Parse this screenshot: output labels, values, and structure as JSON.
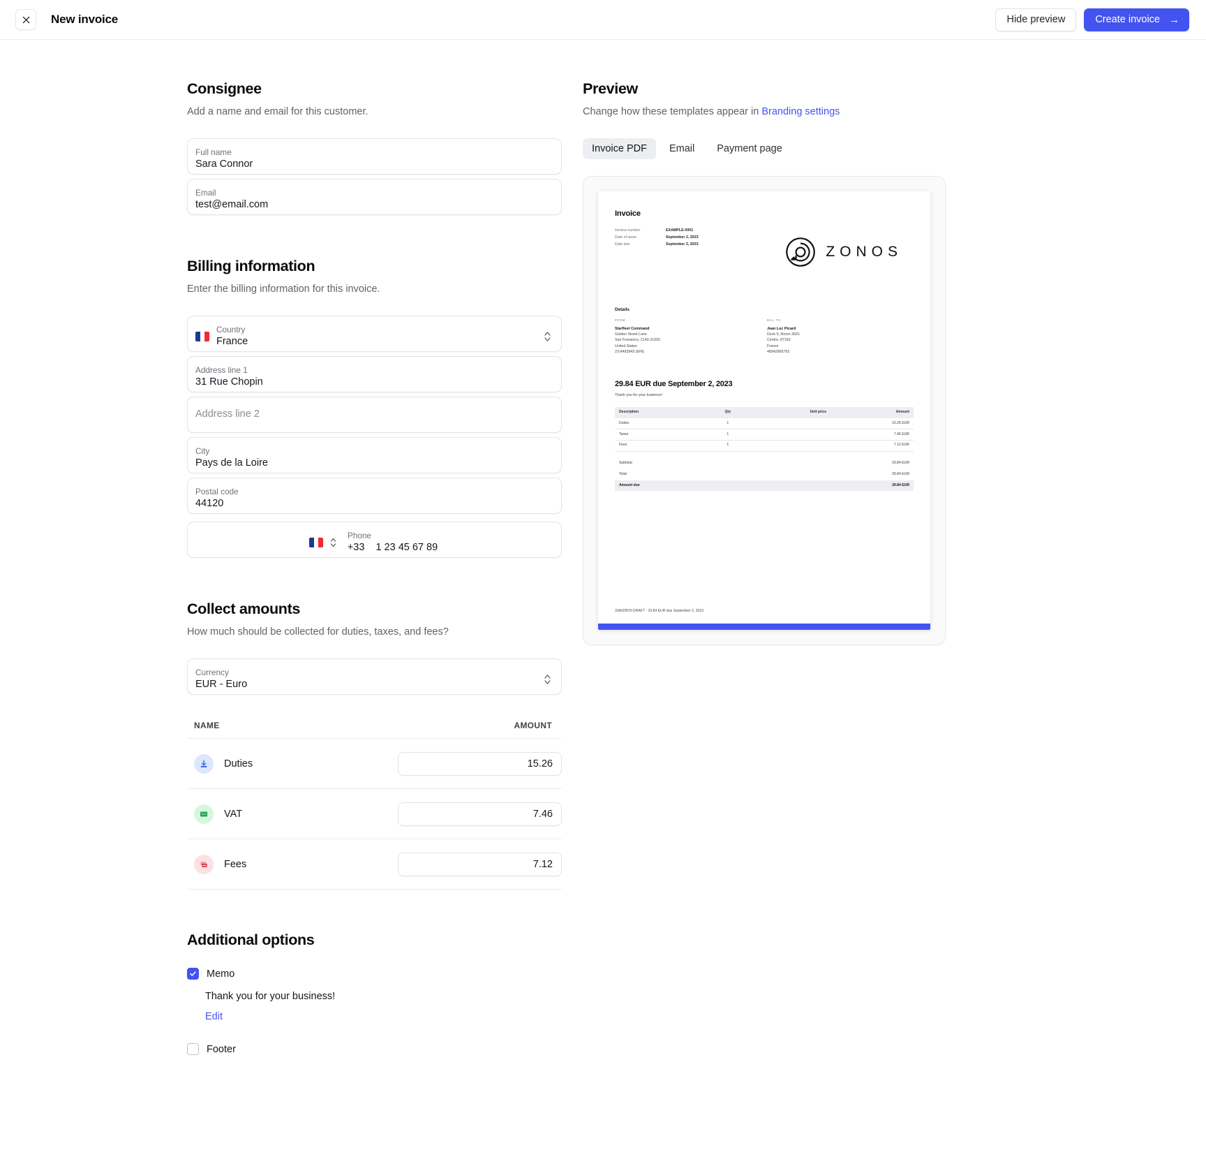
{
  "topbar": {
    "close_icon": "close-icon",
    "title": "New invoice",
    "hide_preview_label": "Hide preview",
    "create_invoice_label": "Create invoice",
    "create_invoice_arrow": "→"
  },
  "consignee": {
    "title": "Consignee",
    "subtitle": "Add a name and email for this customer.",
    "fields": [
      {
        "label": "Full name",
        "value": "Sara Connor"
      },
      {
        "label": "Email",
        "value": "test@email.com"
      }
    ]
  },
  "billing": {
    "title": "Billing information",
    "subtitle": "Enter the billing information for this invoice.",
    "country": {
      "label": "Country",
      "value": "France",
      "flag": "flag-france-icon"
    },
    "address1": {
      "label": "Address line 1",
      "value": "31 Rue Chopin"
    },
    "address2": {
      "label": "",
      "placeholder": "Address line 2",
      "value": ""
    },
    "city": {
      "label": "City",
      "value": "Pays de la Loire"
    },
    "postal": {
      "label": "Postal code",
      "value": "44120"
    },
    "phone": {
      "label": "Phone",
      "dial_code": "+33",
      "value": "1 23 45 67 89",
      "flag": "flag-france-icon"
    }
  },
  "collect": {
    "title": "Collect amounts",
    "subtitle": "How much should be collected for duties, taxes, and fees?",
    "currency": {
      "label": "Currency",
      "value": "EUR - Euro"
    },
    "columns": {
      "name": "NAME",
      "amount": "AMOUNT"
    },
    "rows": [
      {
        "name": "Duties",
        "amount": "15.26",
        "icon": "duties-download-icon",
        "bg": "#dbe7fd",
        "fg": "#3d6fe0"
      },
      {
        "name": "VAT",
        "amount": "7.46",
        "icon": "vat-receipt-icon",
        "bg": "#d6f7df",
        "fg": "#2fa255"
      },
      {
        "name": "Fees",
        "amount": "7.12",
        "icon": "fees-stack-icon",
        "bg": "#fde1e2",
        "fg": "#e05562"
      }
    ]
  },
  "additional": {
    "title": "Additional options",
    "memo": {
      "label": "Memo",
      "checked": true,
      "text": "Thank you for your business!",
      "edit_label": "Edit"
    },
    "footer": {
      "label": "Footer",
      "checked": false
    }
  },
  "preview": {
    "title": "Preview",
    "subtitle_prefix": "Change how these templates appear in ",
    "subtitle_link": "Branding settings",
    "tabs": [
      {
        "label": "Invoice PDF",
        "active": true
      },
      {
        "label": "Email",
        "active": false
      },
      {
        "label": "Payment page",
        "active": false
      }
    ],
    "document": {
      "title": "Invoice",
      "meta": [
        {
          "key": "Invoice number",
          "value": "EXAMPLE-0001"
        },
        {
          "key": "Date of issue",
          "value": "September 2, 2023"
        },
        {
          "key": "Date due",
          "value": "September 2, 2023"
        }
      ],
      "brand_name": "ZONOS",
      "brand_logo": "zonos-logo-icon",
      "details_title": "Details",
      "from": {
        "eyebrow": "FROM",
        "name": "Starfleet Command",
        "lines": [
          "Golden Street Lane",
          "San Fransisco, 2143-21555",
          "United States",
          "23-8493943 (EIN)"
        ]
      },
      "bill_to": {
        "eyebrow": "BILL TO",
        "name": "Jean Luc Picard",
        "lines": [
          "Deck 9, Room 3601",
          "Centre, 87160",
          "France",
          "48942895762"
        ]
      },
      "due_headline": "29.84 EUR due September 2, 2023",
      "memo": "Thank you for your business!",
      "table": {
        "headers": [
          "Description",
          "Qty",
          "Unit price",
          "Amount"
        ],
        "rows": [
          {
            "description": "Duties",
            "qty": "1",
            "unit_price": "",
            "amount": "15.26 EUR"
          },
          {
            "description": "Taxes",
            "qty": "1",
            "unit_price": "",
            "amount": "7.46 EUR"
          },
          {
            "description": "Fees",
            "qty": "1",
            "unit_price": "",
            "amount": "7.12 EUR"
          }
        ]
      },
      "summary": [
        {
          "label": "Subtotal",
          "value": "29.84 EUR",
          "emphasis": false
        },
        {
          "label": "Total",
          "value": "29.84 EUR",
          "emphasis": false
        },
        {
          "label": "Amount due",
          "value": "29.84 EUR",
          "emphasis": true
        }
      ],
      "footer_text": "33A605FD-DRAFT · 29.84 EUR due September 2, 2023"
    }
  },
  "colors": {
    "accent": "#4353f0",
    "link": "#4353f0",
    "tab_active_bg": "#eceef1"
  }
}
